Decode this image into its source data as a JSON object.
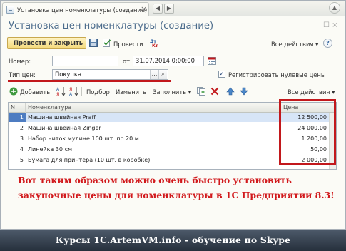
{
  "window": {
    "tab_title": "Установка цен номенклатуры (создание)",
    "tab_close": "×",
    "nav_back": "◀",
    "nav_forward": "▶",
    "window_control": "▲"
  },
  "form": {
    "title": "Установка цен номенклатуры (создание)",
    "title_controls": "☐ ×",
    "post_and_close_label": "Провести и закрыть",
    "post_label": "Провести",
    "all_actions_label": "Все действия ▾",
    "help_label": "?"
  },
  "fields": {
    "number_label": "Номер:",
    "number_value": "",
    "from_label": "от:",
    "date_value": "31.07.2014  0:00:00",
    "price_type_label": "Тип цен:",
    "price_type_value": "Покупка",
    "register_zero_label": "Регистрировать нулевые цены",
    "register_zero_checked": "✓"
  },
  "toolbar": {
    "add_label": "Добавить",
    "select_label": "Подбор",
    "change_label": "Изменить",
    "fill_label": "Заполнить ▾",
    "all_actions_label": "Все действия ▾"
  },
  "table": {
    "columns": [
      "N",
      "Номенклатура",
      "Цена"
    ],
    "rows": [
      {
        "n": "1",
        "item": "Машина швейная Praff",
        "price": "12 500,00"
      },
      {
        "n": "2",
        "item": "Машина швейная Zinger",
        "price": "24 000,00"
      },
      {
        "n": "3",
        "item": "Набор ниток мулине 100 шт. по 20 м",
        "price": "1 200,00"
      },
      {
        "n": "4",
        "item": "Линейка 30 см",
        "price": "50,00"
      },
      {
        "n": "5",
        "item": "Бумага для принтера (10 шт. в коробке)",
        "price": "2 000,00"
      }
    ]
  },
  "overlay": {
    "line1": "Вот таким образом можно очень быстро установить",
    "line2": "закупочные цены для номенклатуры в 1С Предприятии 8.3!"
  },
  "footer": {
    "text": "Курсы 1C.ArtemVM.info - обучение по Skype"
  },
  "colors": {
    "accent_red": "#c2181c",
    "title_blue": "#4c6c8c",
    "selected_row": "#d7e5f7"
  }
}
